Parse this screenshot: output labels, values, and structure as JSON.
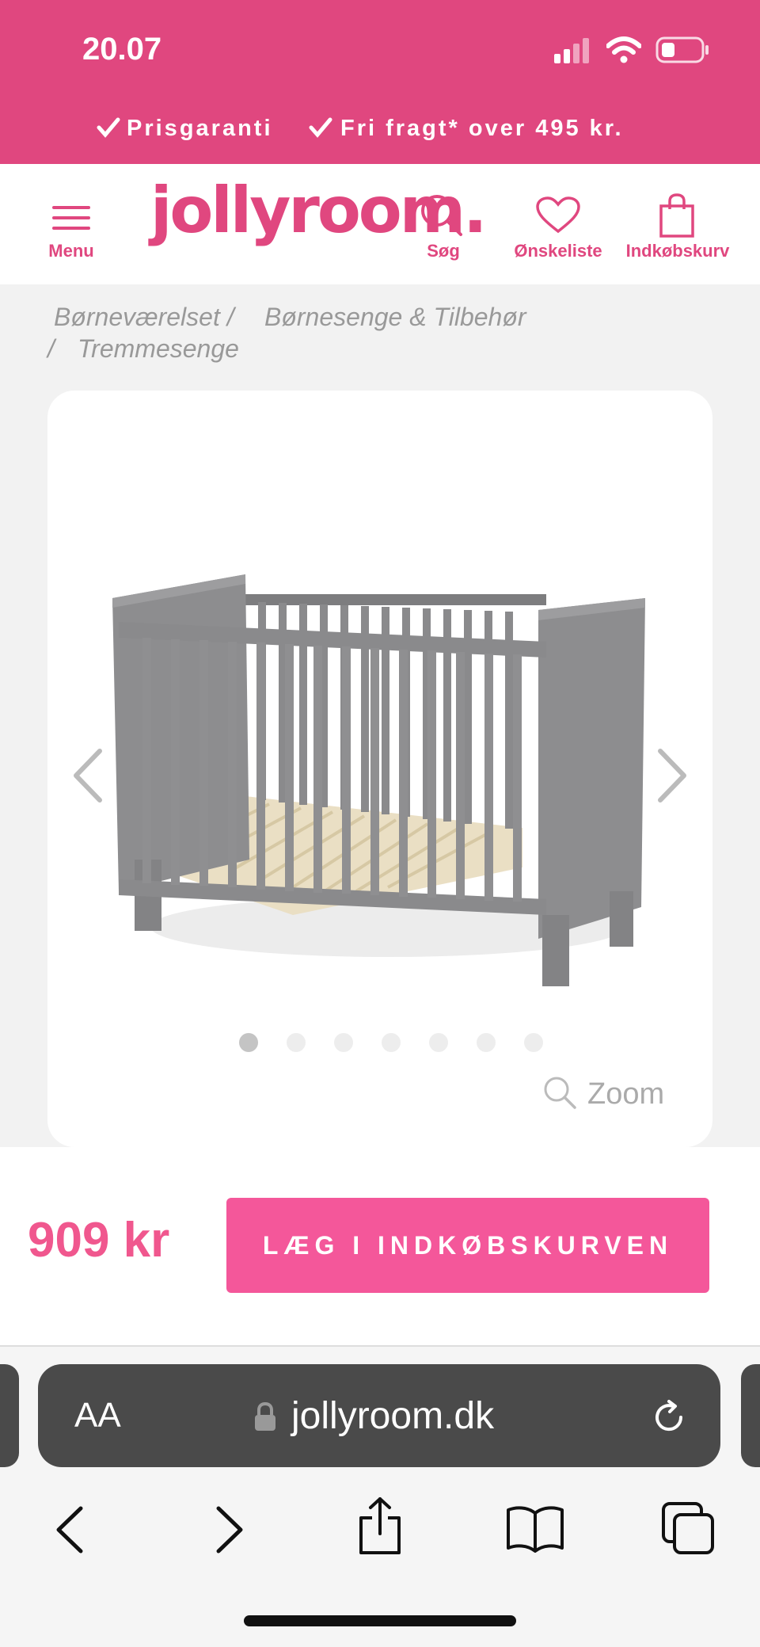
{
  "status_bar": {
    "time": "20.07"
  },
  "promo": {
    "item1": "Prisgaranti",
    "item2": "Fri fragt* over 495 kr."
  },
  "header": {
    "menu_label": "Menu",
    "logo": "jollyroom.",
    "search_label": "Søg",
    "wishlist_label": "Ønskeliste",
    "cart_label": "Indkøbskurv"
  },
  "breadcrumb": {
    "level1": "Børneværelset /",
    "level2": "Børnesenge & Tilbehør",
    "separator": "/",
    "level3": "Tremmesenge"
  },
  "gallery": {
    "image_count": 7,
    "active_index": 0,
    "zoom_label": "Zoom"
  },
  "purchase": {
    "price": "909 kr",
    "add_to_cart_label": "LÆG I INDKØBSKURVEN"
  },
  "browser": {
    "text_size_label": "AA",
    "url": "jollyroom.dk"
  },
  "colors": {
    "brand_pink": "#e0477f",
    "button_pink": "#f4579a"
  }
}
